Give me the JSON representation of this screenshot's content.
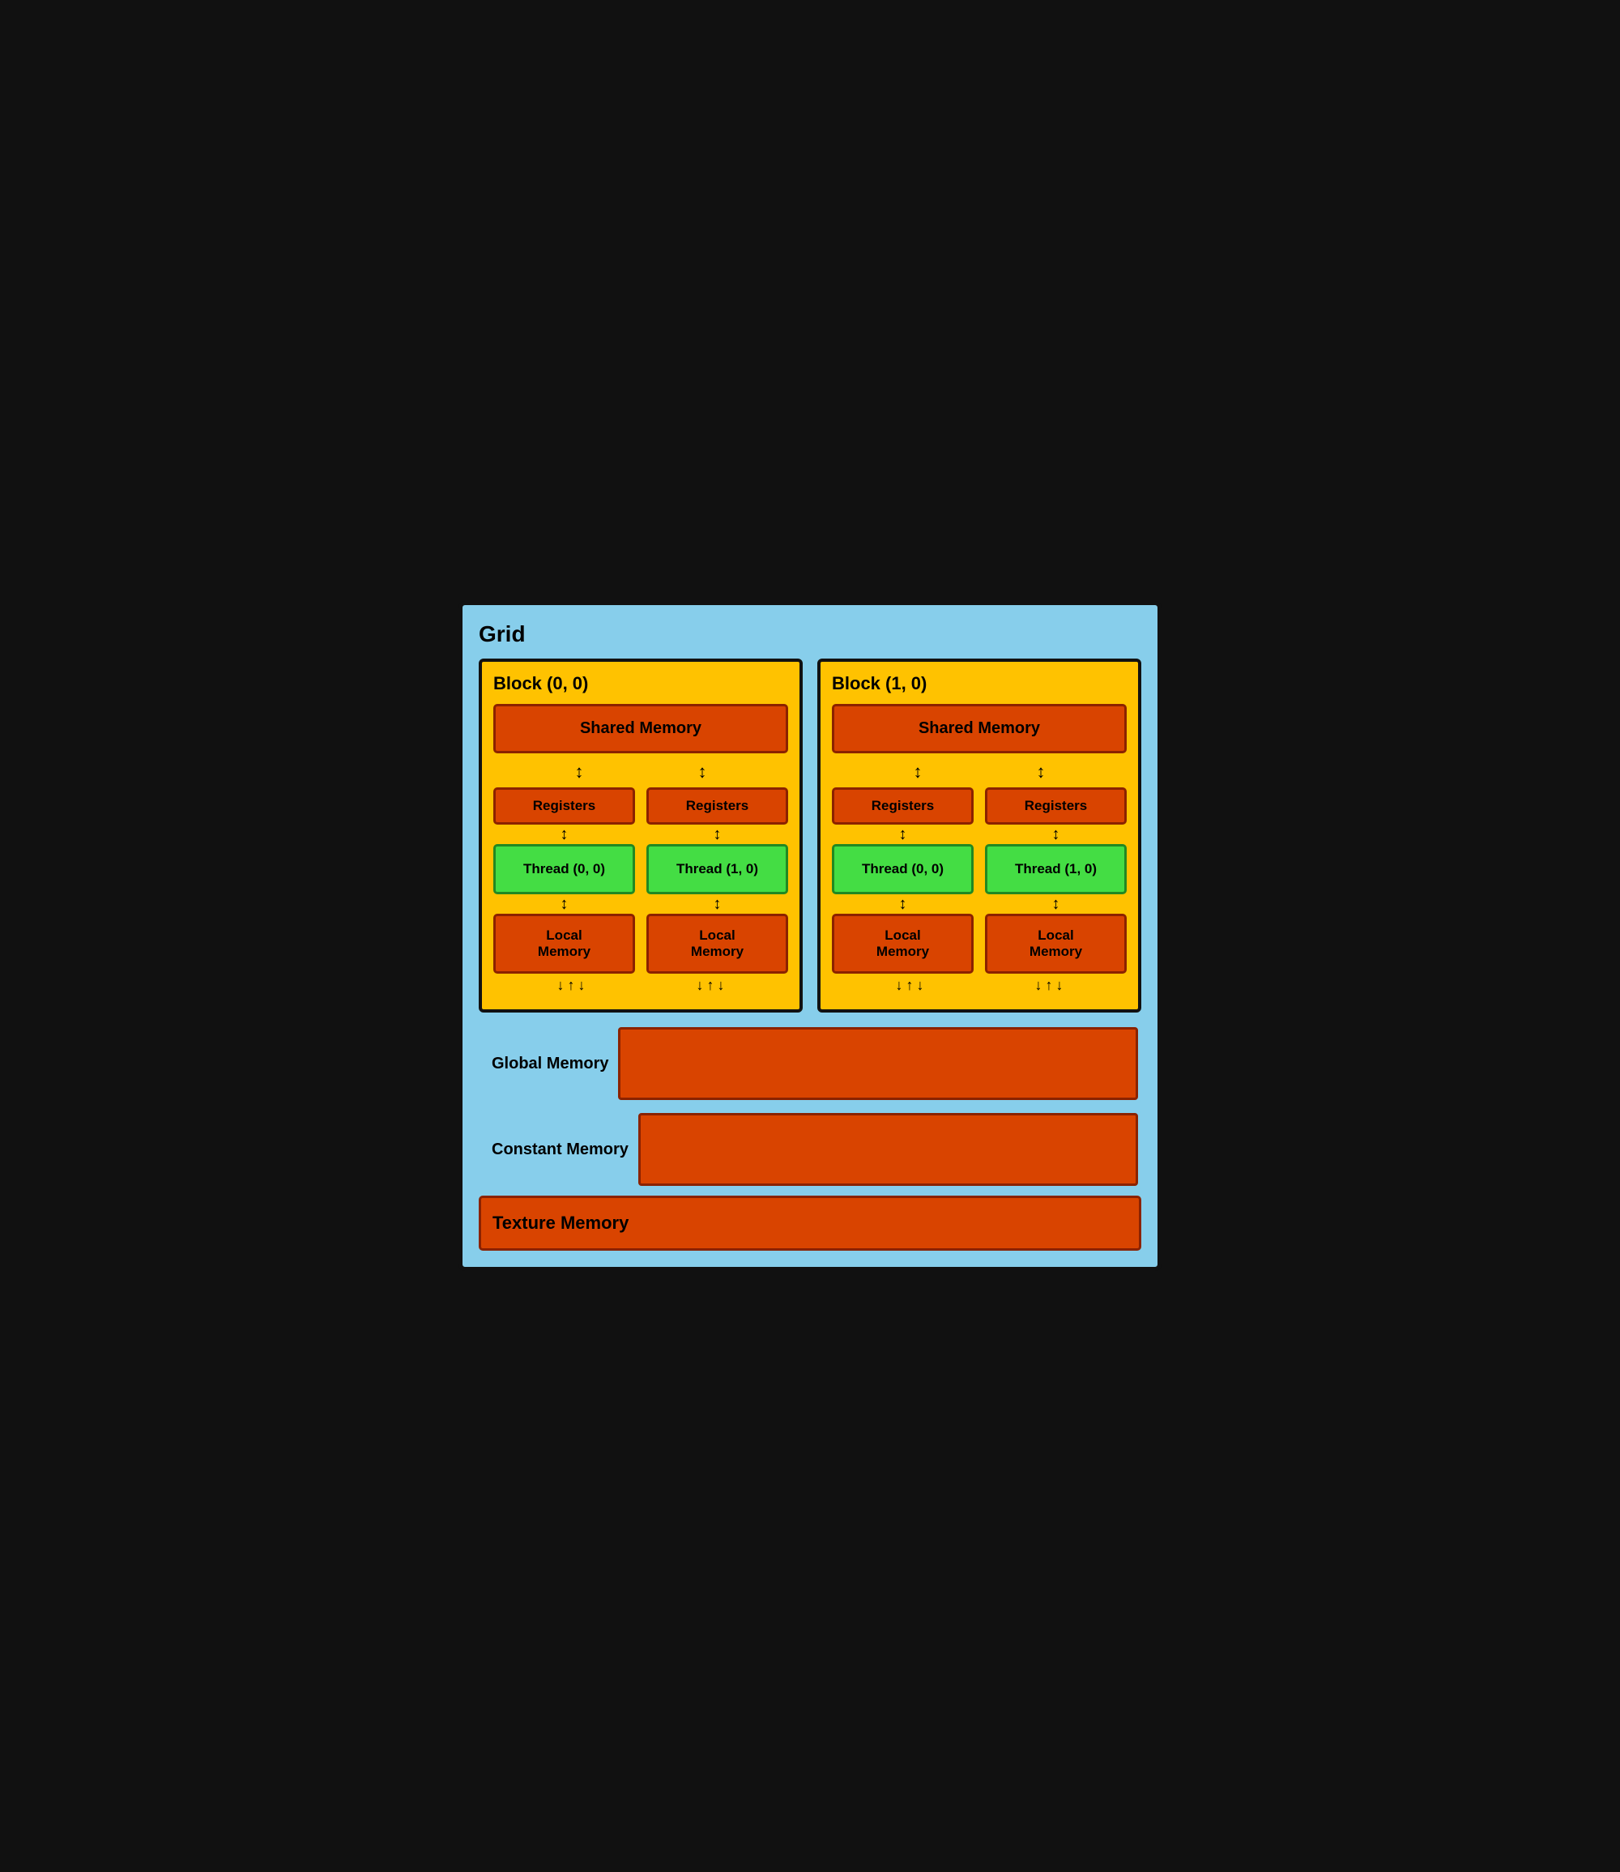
{
  "grid": {
    "label": "Grid",
    "blocks": [
      {
        "id": "block-00",
        "label": "Block (0, 0)",
        "shared_memory": "Shared Memory",
        "threads": [
          {
            "registers": "Registers",
            "label": "Thread (0, 0)",
            "local_memory": "Local Memory"
          },
          {
            "registers": "Registers",
            "label": "Thread (1, 0)",
            "local_memory": "Local Memory"
          }
        ]
      },
      {
        "id": "block-10",
        "label": "Block (1, 0)",
        "shared_memory": "Shared Memory",
        "threads": [
          {
            "registers": "Registers",
            "label": "Thread (0, 0)",
            "local_memory": "Local Memory"
          },
          {
            "registers": "Registers",
            "label": "Thread (1, 0)",
            "local_memory": "Local Memory"
          }
        ]
      }
    ],
    "global_memory": "Global Memory",
    "constant_memory": "Constant Memory",
    "texture_memory": "Texture Memory"
  }
}
